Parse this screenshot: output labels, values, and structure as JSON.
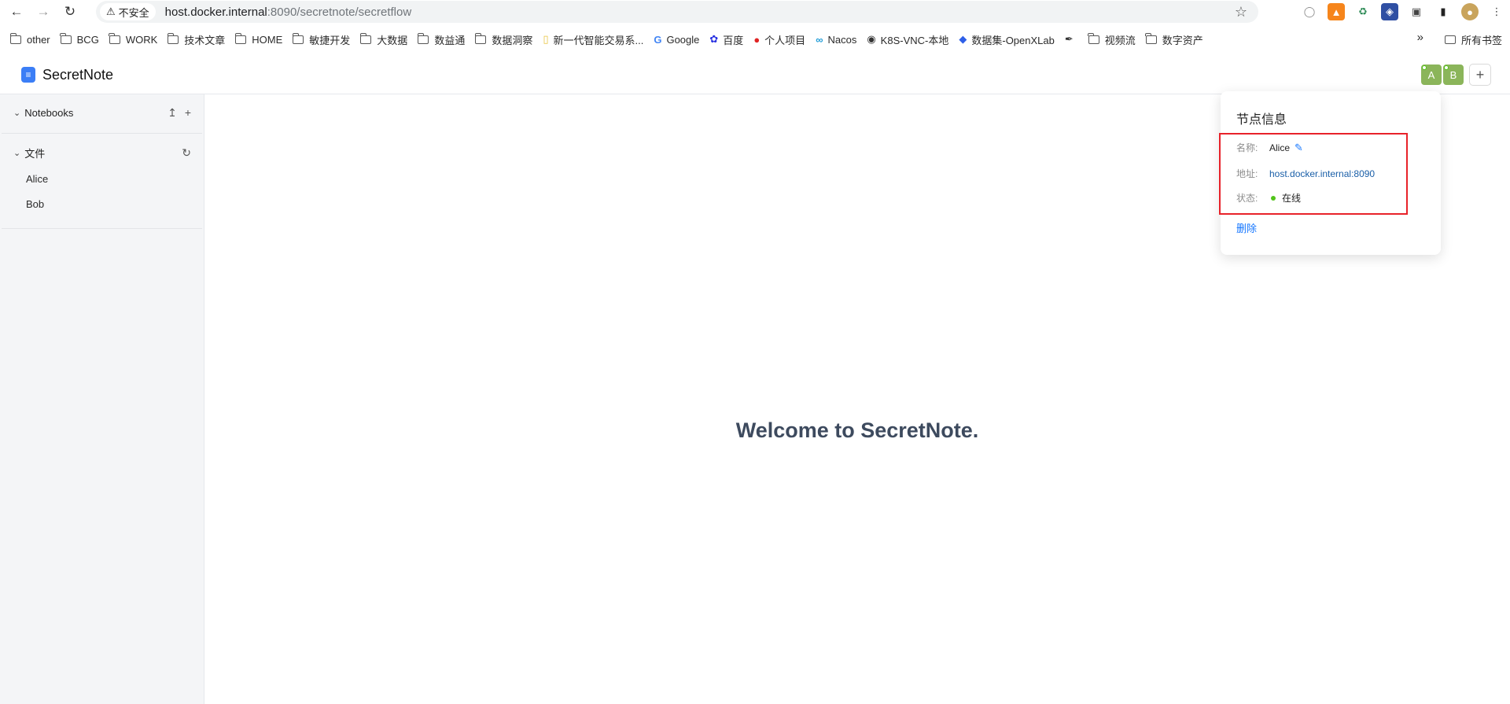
{
  "browser": {
    "insecure_label": "不安全",
    "url_host": "host.docker.internal",
    "url_rest": ":8090/secretnote/secretflow"
  },
  "bookmarks": [
    {
      "label": "other",
      "icon": "folder-icon"
    },
    {
      "label": "BCG",
      "icon": "folder-icon"
    },
    {
      "label": "WORK",
      "icon": "folder-icon"
    },
    {
      "label": "技术文章",
      "icon": "folder-icon"
    },
    {
      "label": "HOME",
      "icon": "folder-icon"
    },
    {
      "label": "敏捷开发",
      "icon": "folder-icon"
    },
    {
      "label": "大数据",
      "icon": "folder-icon"
    },
    {
      "label": "数益通",
      "icon": "folder-icon"
    },
    {
      "label": "数据洞察",
      "icon": "folder-icon"
    },
    {
      "label": "新一代智能交易系...",
      "icon": "page-icon"
    },
    {
      "label": "Google",
      "icon": "google-icon"
    },
    {
      "label": "百度",
      "icon": "baidu-icon"
    },
    {
      "label": "个人项目",
      "icon": "project-icon"
    },
    {
      "label": "Nacos",
      "icon": "nacos-icon"
    },
    {
      "label": "K8S-VNC-本地",
      "icon": "globe-icon"
    },
    {
      "label": "数据集-OpenXLab",
      "icon": "openxlab-icon"
    },
    {
      "label": "",
      "icon": "feather-icon"
    },
    {
      "label": "视频流",
      "icon": "folder-icon"
    },
    {
      "label": "数字资产",
      "icon": "folder-icon"
    }
  ],
  "bookmarks_all": "所有书签",
  "app": {
    "title": "SecretNote",
    "avatars": [
      "A",
      "B"
    ]
  },
  "sidebar": {
    "notebooks_label": "Notebooks",
    "files_label": "文件",
    "files": [
      "Alice",
      "Bob"
    ]
  },
  "main": {
    "welcome": "Welcome to SecretNote."
  },
  "node_popover": {
    "title": "节点信息",
    "name_label": "名称:",
    "name_value": "Alice",
    "address_label": "地址:",
    "address_value": "host.docker.internal:8090",
    "status_label": "状态:",
    "status_value": "在线",
    "delete_label": "删除"
  }
}
